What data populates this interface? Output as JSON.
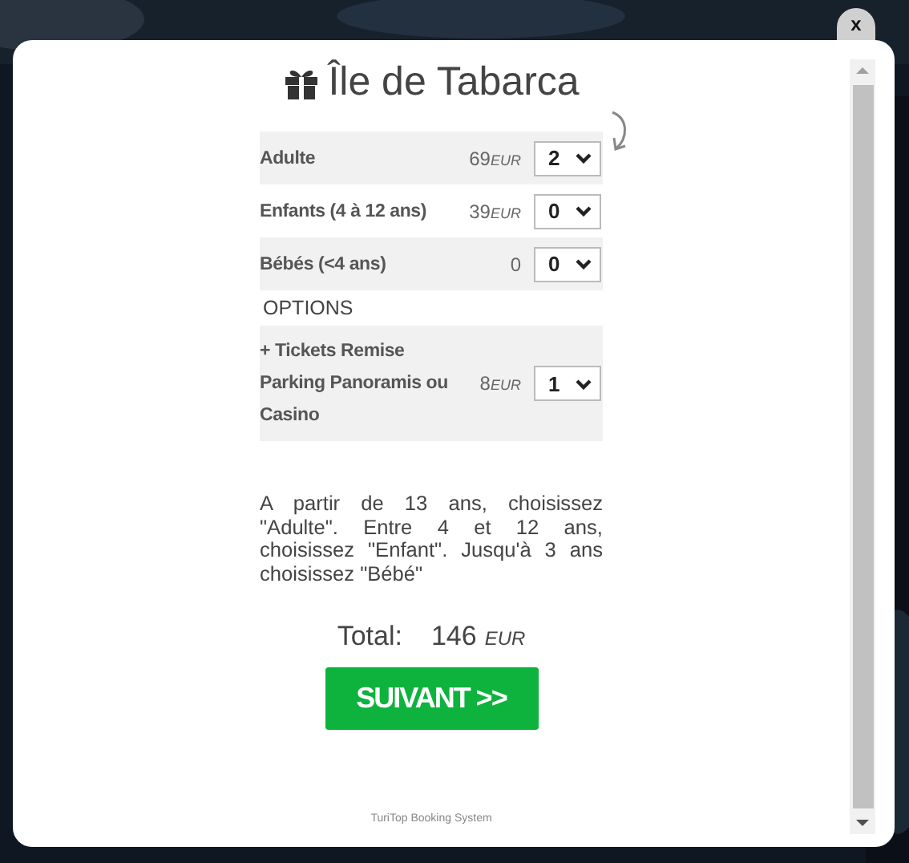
{
  "close_button": {
    "label": "x"
  },
  "title": "Île de Tabarca",
  "tickets": [
    {
      "label": "Adulte",
      "price": "69",
      "currency": "EUR",
      "quantity": "2"
    },
    {
      "label": "Enfants (4 à 12 ans)",
      "price": "39",
      "currency": "EUR",
      "quantity": "0"
    },
    {
      "label": "Bébés (<4 ans)",
      "price": "0",
      "quantity": "0"
    }
  ],
  "options_heading": "OPTIONS",
  "options": [
    {
      "label": "+ Tickets Remise Parking Panoramis ou Casino",
      "price": "8",
      "currency": "EUR",
      "quantity": "1"
    }
  ],
  "note": "A partir de 13 ans, choisissez \"Adulte\". Entre 4 et 12 ans, choisissez \"Enfant\". Jusqu'à 3 ans choisissez \"Bébé\"",
  "total": {
    "label": "Total:",
    "amount": "146",
    "currency": "EUR"
  },
  "next_button": "SUIVANT >>",
  "footer": "TuriTop Booking System"
}
